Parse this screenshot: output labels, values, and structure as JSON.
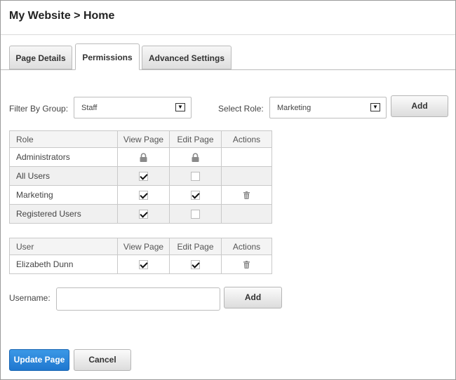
{
  "header": {
    "title": "My Website > Home"
  },
  "tabs": [
    {
      "label": "Page Details",
      "active": false
    },
    {
      "label": "Permissions",
      "active": true
    },
    {
      "label": "Advanced Settings",
      "active": false
    }
  ],
  "filter": {
    "group_label": "Filter By Group:",
    "group_value": "Staff",
    "role_label": "Select Role:",
    "role_value": "Marketing",
    "add_label": "Add"
  },
  "roles_table": {
    "columns": [
      "Role",
      "View Page",
      "Edit Page",
      "Actions"
    ],
    "rows": [
      {
        "name": "Administrators",
        "view": "locked",
        "edit": "locked",
        "action": ""
      },
      {
        "name": "All Users",
        "view": "checked",
        "edit": "unchecked",
        "action": ""
      },
      {
        "name": "Marketing",
        "view": "checked",
        "edit": "checked",
        "action": "trash-icon"
      },
      {
        "name": "Registered Users",
        "view": "checked",
        "edit": "unchecked",
        "action": ""
      }
    ]
  },
  "users_table": {
    "columns": [
      "User",
      "View Page",
      "Edit Page",
      "Actions"
    ],
    "rows": [
      {
        "name": "Elizabeth Dunn",
        "view": "checked",
        "edit": "checked",
        "action": "trash-icon"
      }
    ]
  },
  "username": {
    "label": "Username:",
    "value": "",
    "add_label": "Add"
  },
  "footer": {
    "update_label": "Update Page",
    "cancel_label": "Cancel"
  },
  "colors": {
    "primary_button": "#2a86db",
    "border": "#c9c9c9"
  }
}
